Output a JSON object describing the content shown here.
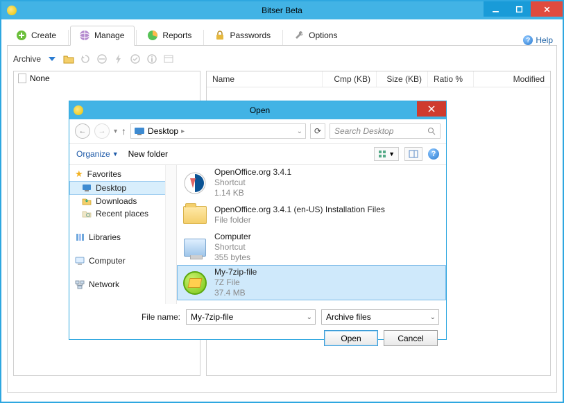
{
  "window": {
    "title": "Bitser Beta"
  },
  "tabs": {
    "create": "Create",
    "manage": "Manage",
    "reports": "Reports",
    "passwords": "Passwords",
    "options": "Options"
  },
  "help": "Help",
  "toolbar": {
    "archive_label": "Archive"
  },
  "tree": {
    "root": "None"
  },
  "columns": {
    "name": "Name",
    "cmp": "Cmp (KB)",
    "size": "Size (KB)",
    "ratio": "Ratio %",
    "modified": "Modified"
  },
  "dialog": {
    "title": "Open",
    "crumb": "Desktop",
    "crumb_sep": "▸",
    "search_placeholder": "Search Desktop",
    "organize": "Organize",
    "new_folder": "New folder",
    "nav": {
      "favorites": "Favorites",
      "desktop": "Desktop",
      "downloads": "Downloads",
      "recent": "Recent places",
      "libraries": "Libraries",
      "computer": "Computer",
      "network": "Network"
    },
    "items": [
      {
        "name": "OpenOffice.org 3.4.1",
        "l2": "Shortcut",
        "l3": "1.14 KB"
      },
      {
        "name": "OpenOffice.org 3.4.1 (en-US) Installation Files",
        "l2": "File folder",
        "l3": ""
      },
      {
        "name": "Computer",
        "l2": "Shortcut",
        "l3": "355 bytes"
      },
      {
        "name": "My-7zip-file",
        "l2": "7Z File",
        "l3": "37.4 MB"
      }
    ],
    "filename_label": "File name:",
    "filename_value": "My-7zip-file",
    "filter": "Archive files",
    "open_btn": "Open",
    "cancel_btn": "Cancel"
  }
}
